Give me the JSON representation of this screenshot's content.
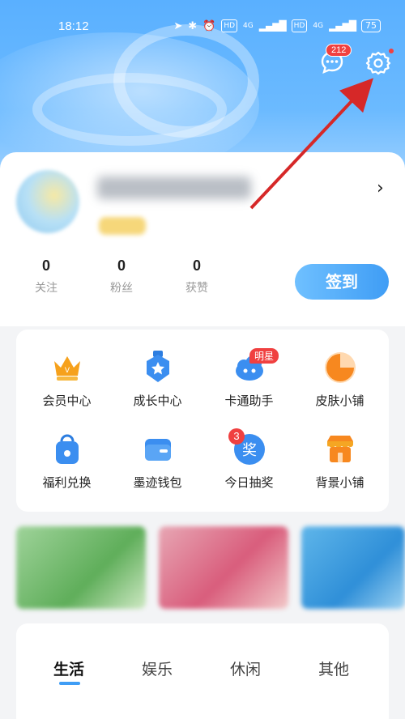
{
  "status_bar": {
    "time": "18:12",
    "network_a": "4G",
    "network_b": "4G",
    "hd_a": "HD",
    "hd_b": "HD",
    "battery": "75"
  },
  "header": {
    "message_badge": "212",
    "icons": [
      "message-icon",
      "settings-icon"
    ]
  },
  "profile": {
    "stats": [
      {
        "value": "0",
        "label": "关注"
      },
      {
        "value": "0",
        "label": "粉丝"
      },
      {
        "value": "0",
        "label": "获赞"
      }
    ],
    "signin_label": "签到"
  },
  "services": [
    {
      "label": "会员中心",
      "icon": "crown-icon"
    },
    {
      "label": "成长中心",
      "icon": "growth-medal-icon"
    },
    {
      "label": "卡通助手",
      "icon": "cartoon-cloud-icon",
      "tag": "明星"
    },
    {
      "label": "皮肤小铺",
      "icon": "skin-pie-icon"
    },
    {
      "label": "福利兑换",
      "icon": "gift-bag-icon"
    },
    {
      "label": "墨迹钱包",
      "icon": "wallet-icon"
    },
    {
      "label": "今日抽奖",
      "icon": "lottery-icon",
      "badge": "3",
      "glyph": "奖"
    },
    {
      "label": "背景小铺",
      "icon": "shop-icon"
    }
  ],
  "tabs": [
    {
      "label": "生活",
      "active": true
    },
    {
      "label": "娱乐",
      "active": false
    },
    {
      "label": "休闲",
      "active": false
    },
    {
      "label": "其他",
      "active": false
    }
  ],
  "colors": {
    "accent": "#3f9df5",
    "badge_red": "#f04040",
    "annotation_arrow": "#d62828"
  }
}
